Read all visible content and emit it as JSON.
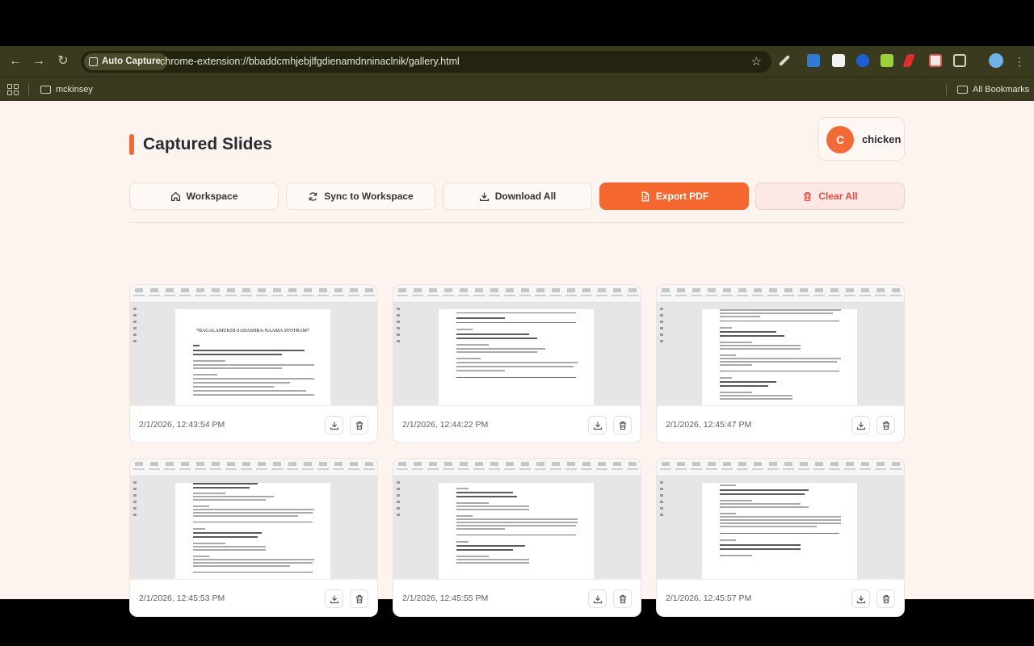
{
  "browser": {
    "chip_label": "Auto Capture",
    "url": "chrome-extension://bbaddcmhjebjlfgdienamdnninaclnik/gallery.html",
    "bookmarks": [
      {
        "label": "mckinsey"
      }
    ],
    "all_bookmarks_label": "All Bookmarks"
  },
  "header": {
    "title": "Captured Slides",
    "user_initial": "C",
    "user_name": "chicken"
  },
  "actions": {
    "workspace": "Workspace",
    "sync": "Sync to Workspace",
    "download_all": "Download All",
    "export_pdf": "Export PDF",
    "clear_all": "Clear All"
  },
  "slides": [
    {
      "timestamp": "2/1/2026, 12:43:54 PM",
      "doc_title": "*BAGALAMUKHI-SAHASHRA-NAAMA STOTRAM*"
    },
    {
      "timestamp": "2/1/2026, 12:44:22 PM"
    },
    {
      "timestamp": "2/1/2026, 12:45:47 PM"
    },
    {
      "timestamp": "2/1/2026, 12:45:53 PM"
    },
    {
      "timestamp": "2/1/2026, 12:45:55 PM"
    },
    {
      "timestamp": "2/1/2026, 12:45:57 PM"
    }
  ],
  "colors": {
    "accent": "#f4672f",
    "danger": "#e64a3e",
    "background": "#fdf3ef"
  }
}
